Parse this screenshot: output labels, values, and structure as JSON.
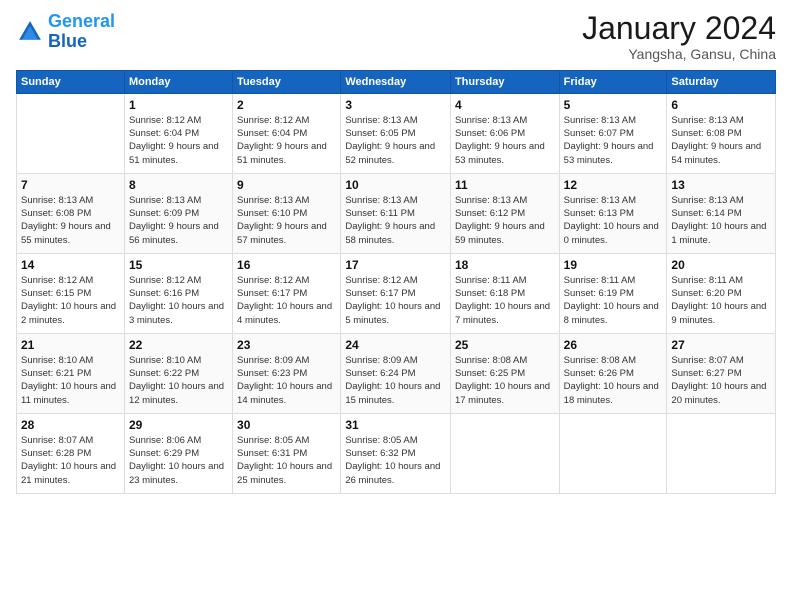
{
  "header": {
    "logo_line1": "General",
    "logo_line2": "Blue",
    "month": "January 2024",
    "location": "Yangsha, Gansu, China"
  },
  "weekdays": [
    "Sunday",
    "Monday",
    "Tuesday",
    "Wednesday",
    "Thursday",
    "Friday",
    "Saturday"
  ],
  "weeks": [
    [
      {
        "day": "",
        "sunrise": "",
        "sunset": "",
        "daylight": ""
      },
      {
        "day": "1",
        "sunrise": "Sunrise: 8:12 AM",
        "sunset": "Sunset: 6:04 PM",
        "daylight": "Daylight: 9 hours and 51 minutes."
      },
      {
        "day": "2",
        "sunrise": "Sunrise: 8:12 AM",
        "sunset": "Sunset: 6:04 PM",
        "daylight": "Daylight: 9 hours and 51 minutes."
      },
      {
        "day": "3",
        "sunrise": "Sunrise: 8:13 AM",
        "sunset": "Sunset: 6:05 PM",
        "daylight": "Daylight: 9 hours and 52 minutes."
      },
      {
        "day": "4",
        "sunrise": "Sunrise: 8:13 AM",
        "sunset": "Sunset: 6:06 PM",
        "daylight": "Daylight: 9 hours and 53 minutes."
      },
      {
        "day": "5",
        "sunrise": "Sunrise: 8:13 AM",
        "sunset": "Sunset: 6:07 PM",
        "daylight": "Daylight: 9 hours and 53 minutes."
      },
      {
        "day": "6",
        "sunrise": "Sunrise: 8:13 AM",
        "sunset": "Sunset: 6:08 PM",
        "daylight": "Daylight: 9 hours and 54 minutes."
      }
    ],
    [
      {
        "day": "7",
        "sunrise": "Sunrise: 8:13 AM",
        "sunset": "Sunset: 6:08 PM",
        "daylight": "Daylight: 9 hours and 55 minutes."
      },
      {
        "day": "8",
        "sunrise": "Sunrise: 8:13 AM",
        "sunset": "Sunset: 6:09 PM",
        "daylight": "Daylight: 9 hours and 56 minutes."
      },
      {
        "day": "9",
        "sunrise": "Sunrise: 8:13 AM",
        "sunset": "Sunset: 6:10 PM",
        "daylight": "Daylight: 9 hours and 57 minutes."
      },
      {
        "day": "10",
        "sunrise": "Sunrise: 8:13 AM",
        "sunset": "Sunset: 6:11 PM",
        "daylight": "Daylight: 9 hours and 58 minutes."
      },
      {
        "day": "11",
        "sunrise": "Sunrise: 8:13 AM",
        "sunset": "Sunset: 6:12 PM",
        "daylight": "Daylight: 9 hours and 59 minutes."
      },
      {
        "day": "12",
        "sunrise": "Sunrise: 8:13 AM",
        "sunset": "Sunset: 6:13 PM",
        "daylight": "Daylight: 10 hours and 0 minutes."
      },
      {
        "day": "13",
        "sunrise": "Sunrise: 8:13 AM",
        "sunset": "Sunset: 6:14 PM",
        "daylight": "Daylight: 10 hours and 1 minute."
      }
    ],
    [
      {
        "day": "14",
        "sunrise": "Sunrise: 8:12 AM",
        "sunset": "Sunset: 6:15 PM",
        "daylight": "Daylight: 10 hours and 2 minutes."
      },
      {
        "day": "15",
        "sunrise": "Sunrise: 8:12 AM",
        "sunset": "Sunset: 6:16 PM",
        "daylight": "Daylight: 10 hours and 3 minutes."
      },
      {
        "day": "16",
        "sunrise": "Sunrise: 8:12 AM",
        "sunset": "Sunset: 6:17 PM",
        "daylight": "Daylight: 10 hours and 4 minutes."
      },
      {
        "day": "17",
        "sunrise": "Sunrise: 8:12 AM",
        "sunset": "Sunset: 6:17 PM",
        "daylight": "Daylight: 10 hours and 5 minutes."
      },
      {
        "day": "18",
        "sunrise": "Sunrise: 8:11 AM",
        "sunset": "Sunset: 6:18 PM",
        "daylight": "Daylight: 10 hours and 7 minutes."
      },
      {
        "day": "19",
        "sunrise": "Sunrise: 8:11 AM",
        "sunset": "Sunset: 6:19 PM",
        "daylight": "Daylight: 10 hours and 8 minutes."
      },
      {
        "day": "20",
        "sunrise": "Sunrise: 8:11 AM",
        "sunset": "Sunset: 6:20 PM",
        "daylight": "Daylight: 10 hours and 9 minutes."
      }
    ],
    [
      {
        "day": "21",
        "sunrise": "Sunrise: 8:10 AM",
        "sunset": "Sunset: 6:21 PM",
        "daylight": "Daylight: 10 hours and 11 minutes."
      },
      {
        "day": "22",
        "sunrise": "Sunrise: 8:10 AM",
        "sunset": "Sunset: 6:22 PM",
        "daylight": "Daylight: 10 hours and 12 minutes."
      },
      {
        "day": "23",
        "sunrise": "Sunrise: 8:09 AM",
        "sunset": "Sunset: 6:23 PM",
        "daylight": "Daylight: 10 hours and 14 minutes."
      },
      {
        "day": "24",
        "sunrise": "Sunrise: 8:09 AM",
        "sunset": "Sunset: 6:24 PM",
        "daylight": "Daylight: 10 hours and 15 minutes."
      },
      {
        "day": "25",
        "sunrise": "Sunrise: 8:08 AM",
        "sunset": "Sunset: 6:25 PM",
        "daylight": "Daylight: 10 hours and 17 minutes."
      },
      {
        "day": "26",
        "sunrise": "Sunrise: 8:08 AM",
        "sunset": "Sunset: 6:26 PM",
        "daylight": "Daylight: 10 hours and 18 minutes."
      },
      {
        "day": "27",
        "sunrise": "Sunrise: 8:07 AM",
        "sunset": "Sunset: 6:27 PM",
        "daylight": "Daylight: 10 hours and 20 minutes."
      }
    ],
    [
      {
        "day": "28",
        "sunrise": "Sunrise: 8:07 AM",
        "sunset": "Sunset: 6:28 PM",
        "daylight": "Daylight: 10 hours and 21 minutes."
      },
      {
        "day": "29",
        "sunrise": "Sunrise: 8:06 AM",
        "sunset": "Sunset: 6:29 PM",
        "daylight": "Daylight: 10 hours and 23 minutes."
      },
      {
        "day": "30",
        "sunrise": "Sunrise: 8:05 AM",
        "sunset": "Sunset: 6:31 PM",
        "daylight": "Daylight: 10 hours and 25 minutes."
      },
      {
        "day": "31",
        "sunrise": "Sunrise: 8:05 AM",
        "sunset": "Sunset: 6:32 PM",
        "daylight": "Daylight: 10 hours and 26 minutes."
      },
      {
        "day": "",
        "sunrise": "",
        "sunset": "",
        "daylight": ""
      },
      {
        "day": "",
        "sunrise": "",
        "sunset": "",
        "daylight": ""
      },
      {
        "day": "",
        "sunrise": "",
        "sunset": "",
        "daylight": ""
      }
    ]
  ]
}
